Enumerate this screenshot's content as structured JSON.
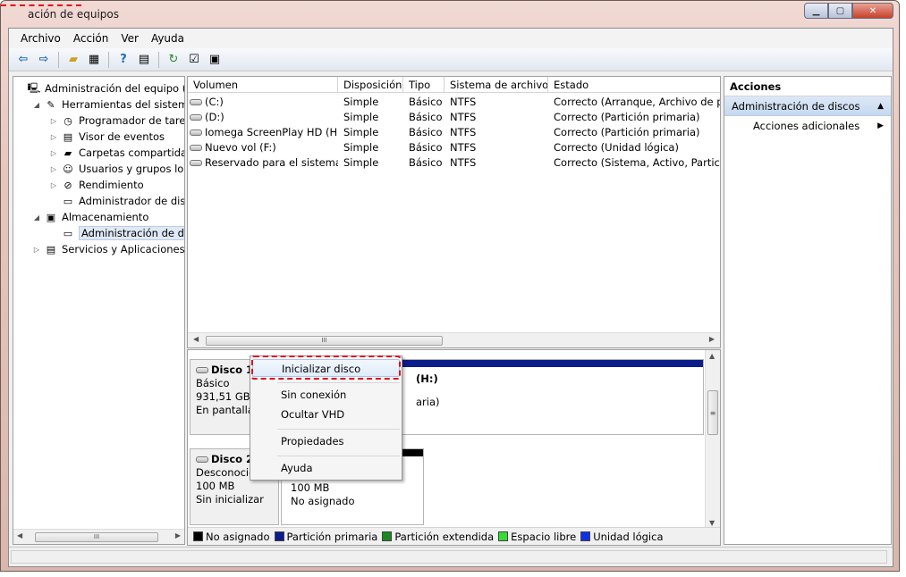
{
  "window": {
    "title": "Administración de equipos",
    "title_visible": "ación de equipos"
  },
  "menubar": [
    "Archivo",
    "Acción",
    "Ver",
    "Ayuda"
  ],
  "toolbar": {
    "icons": [
      "back-arrow-icon",
      "forward-arrow-icon",
      "up-folder-icon",
      "show-tree-icon",
      "help-icon",
      "action-pane-icon",
      "refresh-icon",
      "properties-icon",
      "settings-icon"
    ]
  },
  "tree": {
    "items": [
      {
        "label": "Administración del equipo (loc",
        "icon": "computer-icon",
        "expander": "",
        "indent": 0
      },
      {
        "label": "Herramientas del sistema",
        "icon": "tools-icon",
        "expander": "◢",
        "indent": 1
      },
      {
        "label": "Programador de tareas",
        "icon": "clock-icon",
        "expander": "▷",
        "indent": 2
      },
      {
        "label": "Visor de eventos",
        "icon": "event-viewer-icon",
        "expander": "▷",
        "indent": 2
      },
      {
        "label": "Carpetas compartidas",
        "icon": "shared-folder-icon",
        "expander": "▷",
        "indent": 2
      },
      {
        "label": "Usuarios y grupos locale",
        "icon": "users-icon",
        "expander": "▷",
        "indent": 2
      },
      {
        "label": "Rendimiento",
        "icon": "performance-icon",
        "expander": "▷",
        "indent": 2
      },
      {
        "label": "Administrador de dispo",
        "icon": "device-manager-icon",
        "expander": "",
        "indent": 2
      },
      {
        "label": "Almacenamiento",
        "icon": "storage-icon",
        "expander": "◢",
        "indent": 1
      },
      {
        "label": "Administración de disco",
        "icon": "disk-management-icon",
        "expander": "",
        "indent": 2,
        "selected": true
      },
      {
        "label": "Servicios y Aplicaciones",
        "icon": "services-icon",
        "expander": "▷",
        "indent": 1
      }
    ],
    "hscroll_thumb": "III"
  },
  "volumes": {
    "columns": [
      "Volumen",
      "Disposición",
      "Tipo",
      "Sistema de archivos",
      "Estado"
    ],
    "rows": [
      [
        "(C:)",
        "Simple",
        "Básico",
        "NTFS",
        "Correcto (Arranque, Archivo de pag"
      ],
      [
        "(D:)",
        "Simple",
        "Básico",
        "NTFS",
        "Correcto (Partición primaria)"
      ],
      [
        "Iomega ScreenPlay HD (H:)",
        "Simple",
        "Básico",
        "NTFS",
        "Correcto (Partición primaria)"
      ],
      [
        "Nuevo vol (F:)",
        "Simple",
        "Básico",
        "NTFS",
        "Correcto (Unidad lógica)"
      ],
      [
        "Reservado para el sistema",
        "Simple",
        "Básico",
        "NTFS",
        "Correcto (Sistema, Activo, Partición"
      ]
    ],
    "hscroll_thumb": "III"
  },
  "disks": [
    {
      "name": "Disco 1",
      "type": "Básico",
      "size": "931,51 GB",
      "status": "En pantalla",
      "partition_label": "(H:)",
      "partition_detail": "aria)"
    },
    {
      "name": "Disco 2",
      "type": "Desconocid",
      "size": "100 MB",
      "status": "Sin inicializar",
      "partition_size": "100 MB",
      "partition_status": "No asignado"
    }
  ],
  "legend": [
    {
      "label": "No asignado",
      "color": "#000000"
    },
    {
      "label": "Partición primaria",
      "color": "#0b1d8a"
    },
    {
      "label": "Partición extendida",
      "color": "#1a8a20"
    },
    {
      "label": "Espacio libre",
      "color": "#33dd33"
    },
    {
      "label": "Unidad lógica",
      "color": "#1030e8"
    }
  ],
  "actions": {
    "header": "Acciones",
    "section": "Administración de discos",
    "more": "Acciones adicionales"
  },
  "context_menu": {
    "items": [
      "Inicializar disco",
      "Sin conexión",
      "Ocultar VHD",
      "Propiedades",
      "Ayuda"
    ]
  },
  "colors": {
    "highlight_dash": "#e0101c",
    "primary_partition": "#0b1d8a"
  }
}
